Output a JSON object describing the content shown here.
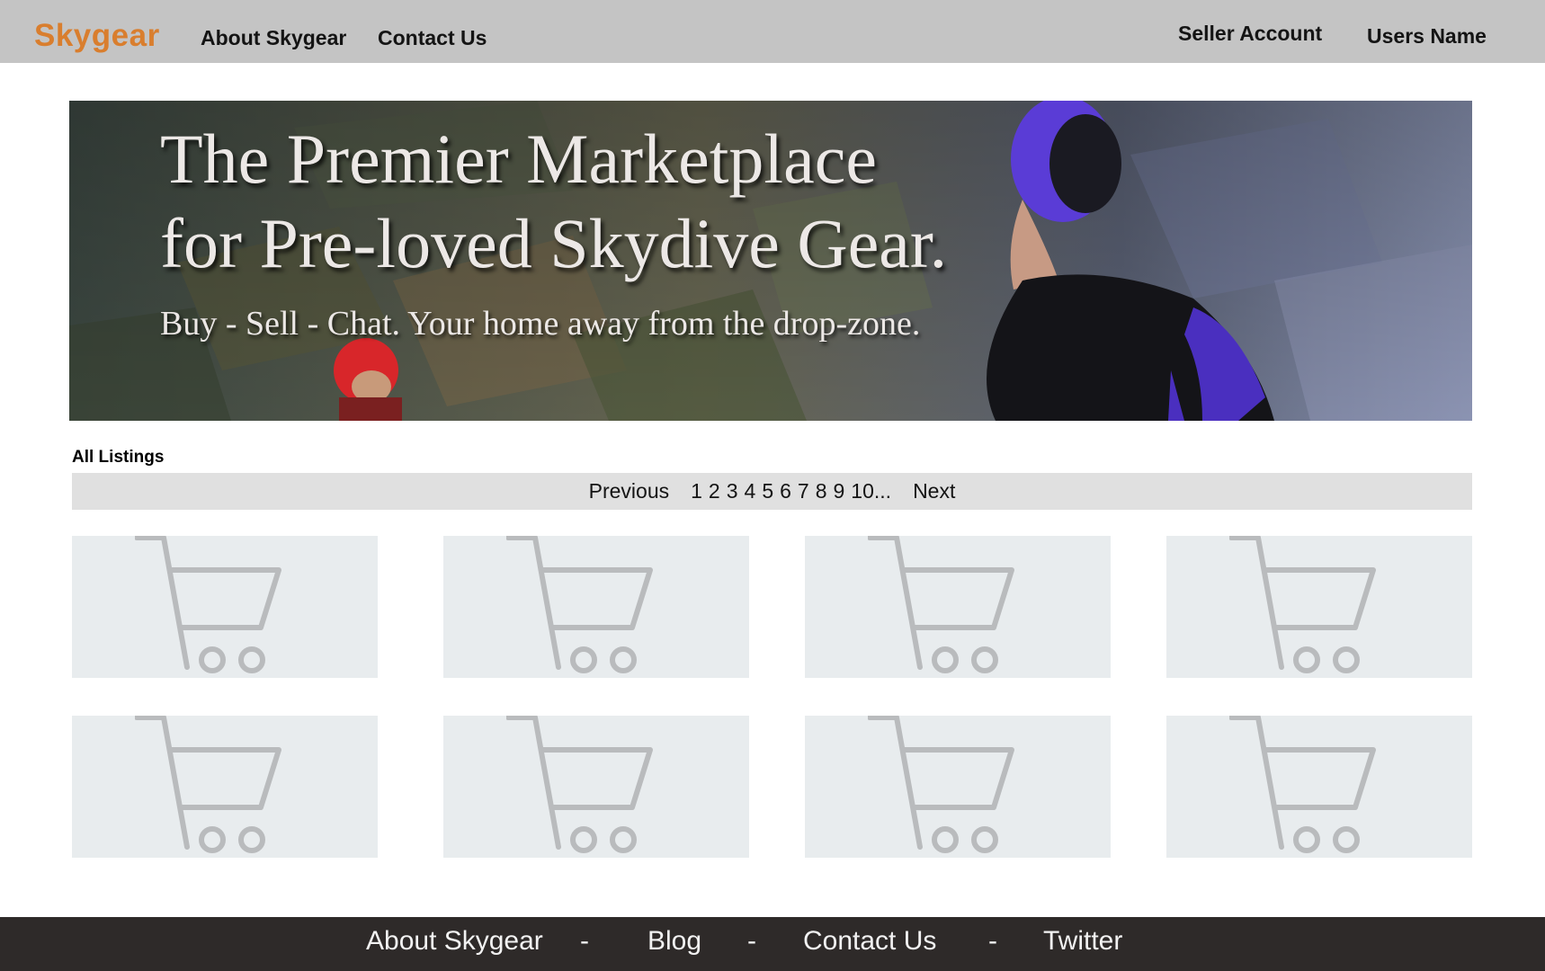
{
  "header": {
    "brand": "Skygear",
    "nav": {
      "about": "About Skygear",
      "contact": "Contact Us",
      "seller": "Seller Account",
      "user": "Users Name"
    }
  },
  "hero": {
    "title_line1": "The Premier Marketplace",
    "title_line2": "for Pre-loved Skydive Gear.",
    "subtitle": "Buy - Sell - Chat. Your home away from the drop-zone."
  },
  "listings": {
    "section_label": "All Listings",
    "pager": {
      "previous": "Previous",
      "pages": [
        "1",
        "2",
        "3",
        "4",
        "5",
        "6",
        "7",
        "8",
        "9",
        "10..."
      ],
      "next": "Next"
    },
    "card_icon": "shopping-cart-icon"
  },
  "footer": {
    "links": [
      "About Skygear",
      "Blog",
      "Contact Us",
      "Twitter"
    ],
    "separator": "-"
  },
  "colors": {
    "brand": "#d97e2e",
    "header_bg": "#c4c4c4",
    "pager_bg": "#e0e0e0",
    "card_bg": "#e8ecee",
    "cart_icon": "#b9bbbd",
    "footer_bg": "#2e2a29"
  }
}
